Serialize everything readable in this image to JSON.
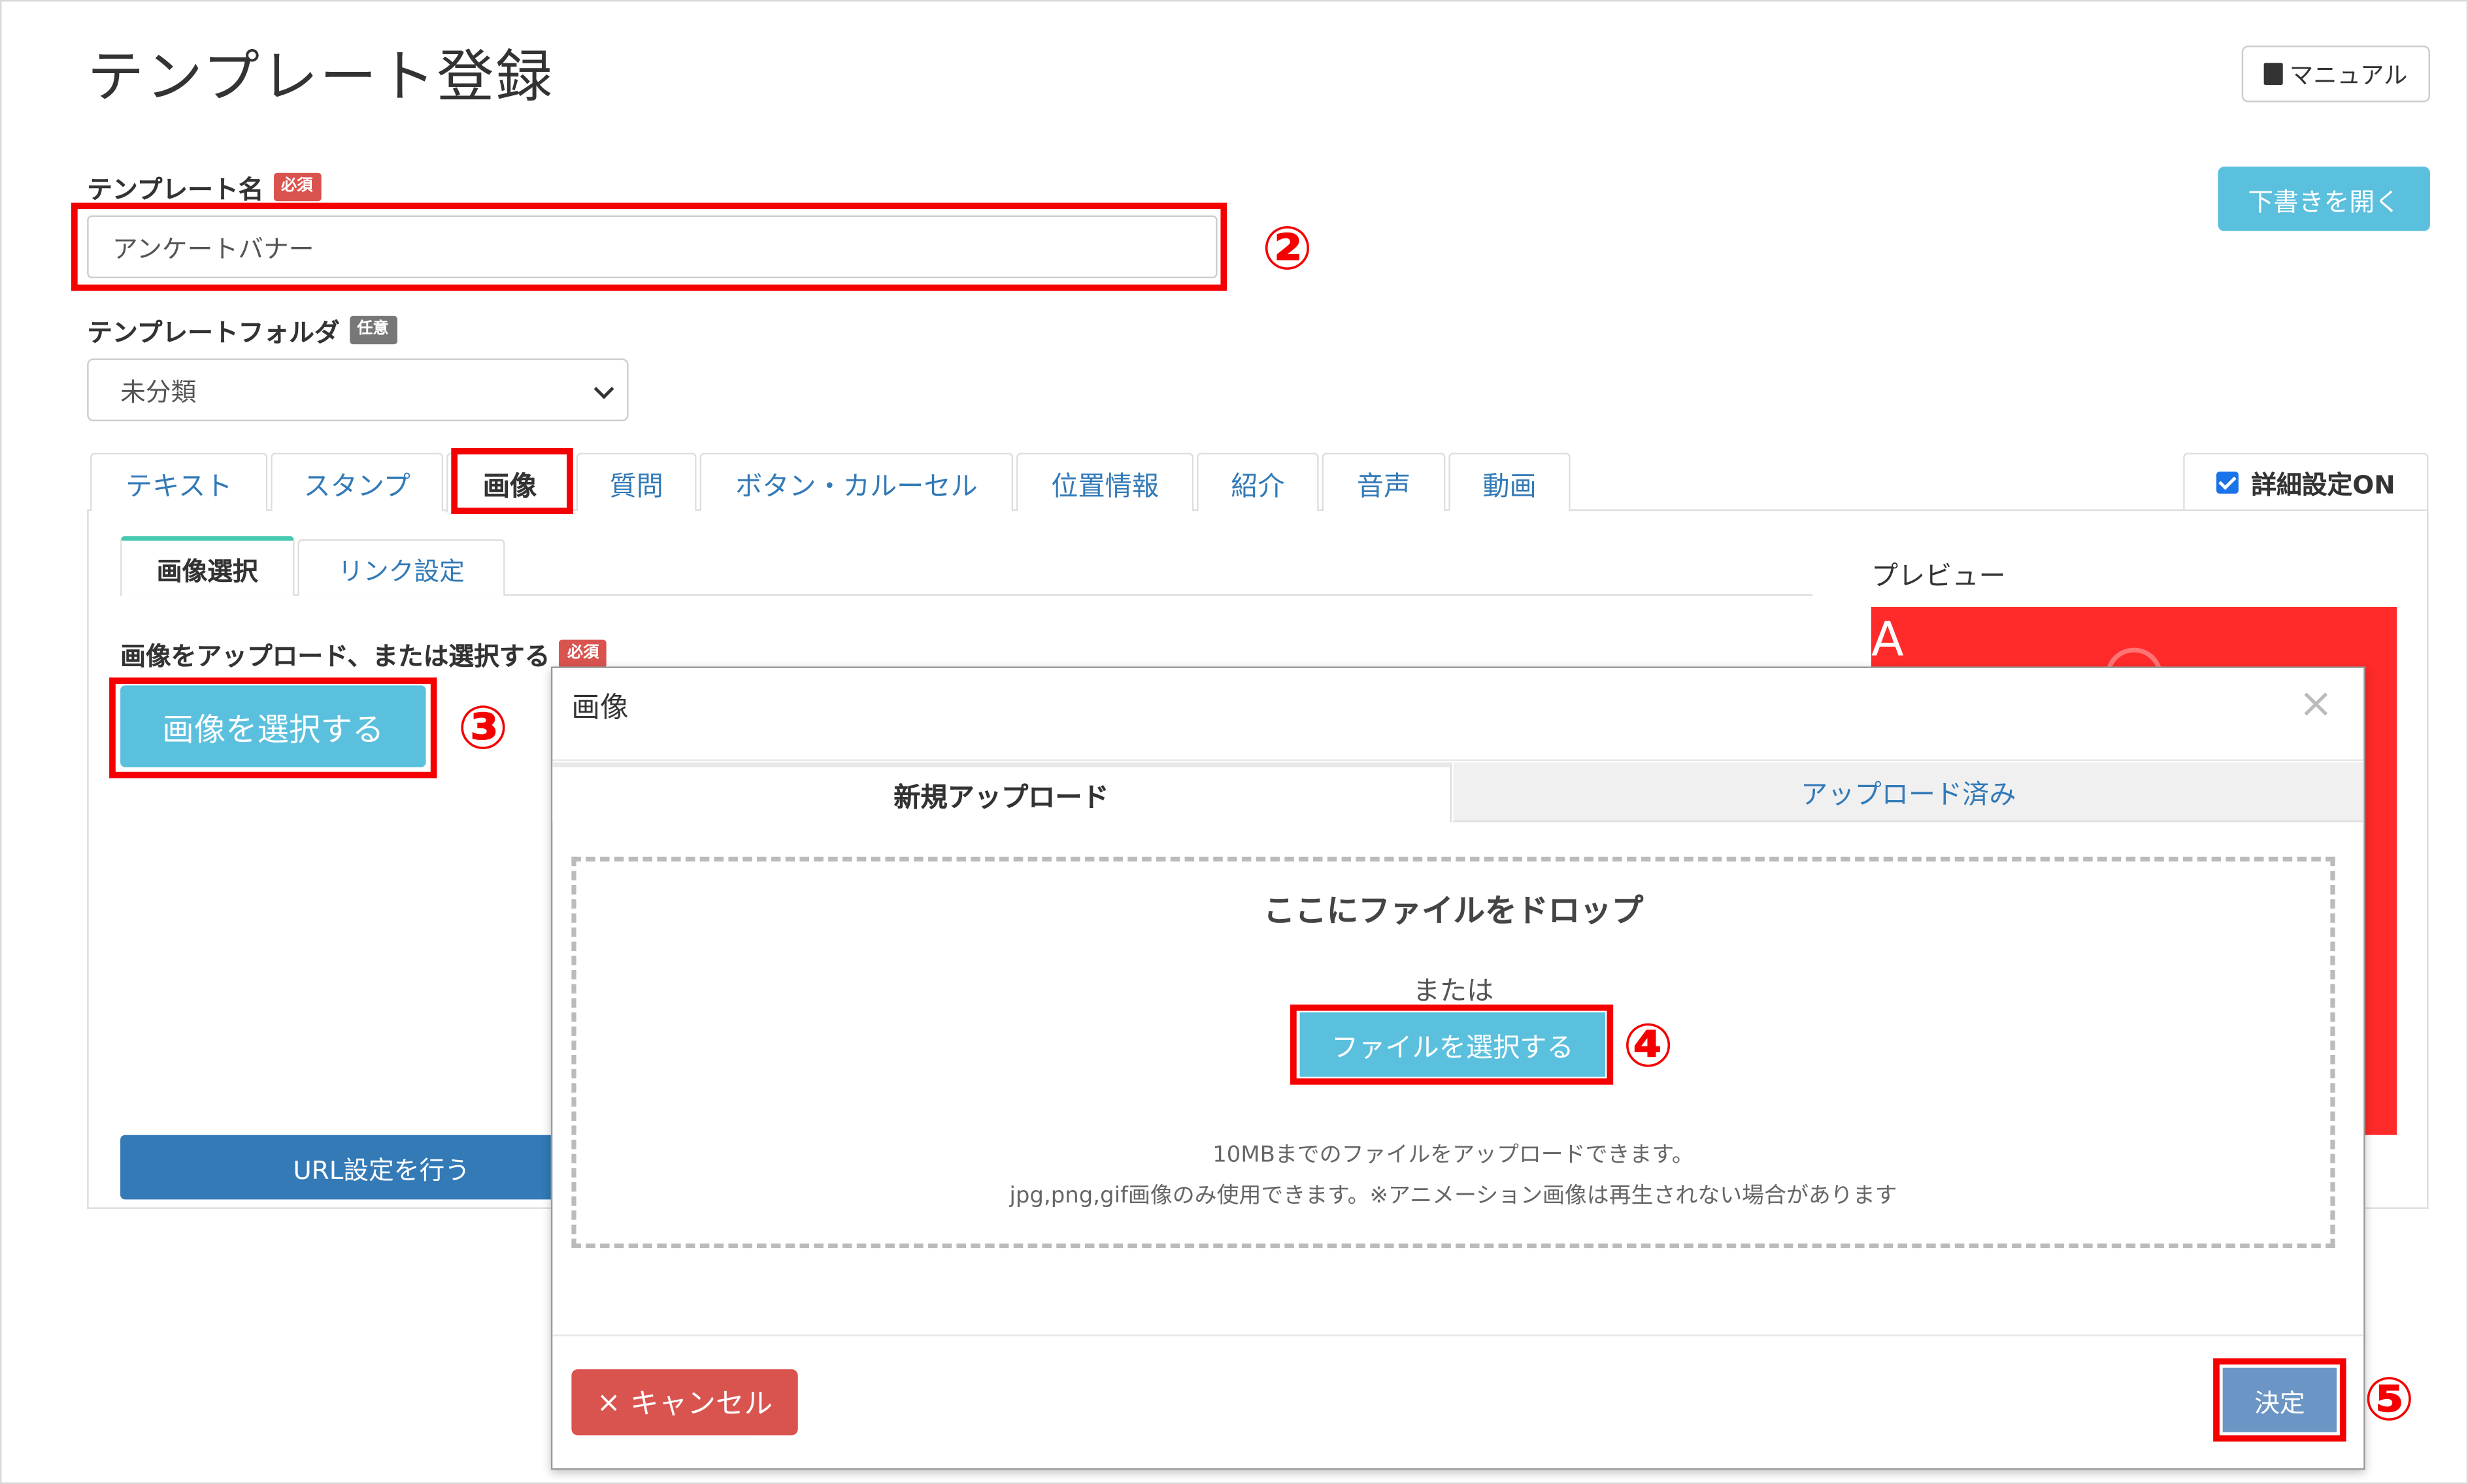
{
  "page": {
    "title": "テンプレート登録",
    "manual_label": "マニュアル",
    "draft_label": "下書きを開く"
  },
  "form": {
    "name_label": "テンプレート名",
    "required_badge": "必須",
    "optional_badge": "任意",
    "name_value": "アンケートバナー",
    "folder_label": "テンプレートフォルダ",
    "folder_value": "未分類"
  },
  "tabs": [
    {
      "label": "テキスト"
    },
    {
      "label": "スタンプ"
    },
    {
      "label": "画像"
    },
    {
      "label": "質問"
    },
    {
      "label": "ボタン・カルーセル"
    },
    {
      "label": "位置情報"
    },
    {
      "label": "紹介"
    },
    {
      "label": "音声"
    },
    {
      "label": "動画"
    }
  ],
  "active_tab": "画像",
  "detail_toggle": {
    "label": "詳細設定ON",
    "checked": true
  },
  "subtabs": [
    {
      "label": "画像選択"
    },
    {
      "label": "リンク設定"
    }
  ],
  "image_section": {
    "upload_label": "画像をアップロード、または選択する",
    "select_button": "画像を選択する",
    "url_button": "URL設定を行う"
  },
  "preview": {
    "label": "プレビュー",
    "image_text": "A",
    "image_color": "#ff2a2a"
  },
  "modal": {
    "title": "画像",
    "close_icon": "×",
    "tabs": [
      {
        "label": "新規アップロード"
      },
      {
        "label": "アップロード済み"
      }
    ],
    "drop_title": "ここにファイルをドロップ",
    "or_text": "または",
    "file_button": "ファイルを選択する",
    "note_1": "10MBまでのファイルをアップロードできます。",
    "note_2": "jpg,png,gif画像のみ使用できます。※アニメーション画像は再生されない場合があります",
    "cancel_icon": "×",
    "cancel_label": "キャンセル",
    "confirm_label": "決定"
  },
  "annotations": {
    "n2": "②",
    "n3": "③",
    "n4": "④",
    "n5": "⑤"
  },
  "colors": {
    "highlight": "#f40000",
    "info": "#5bc0de",
    "primary": "#337ab7",
    "danger": "#d9534f"
  }
}
